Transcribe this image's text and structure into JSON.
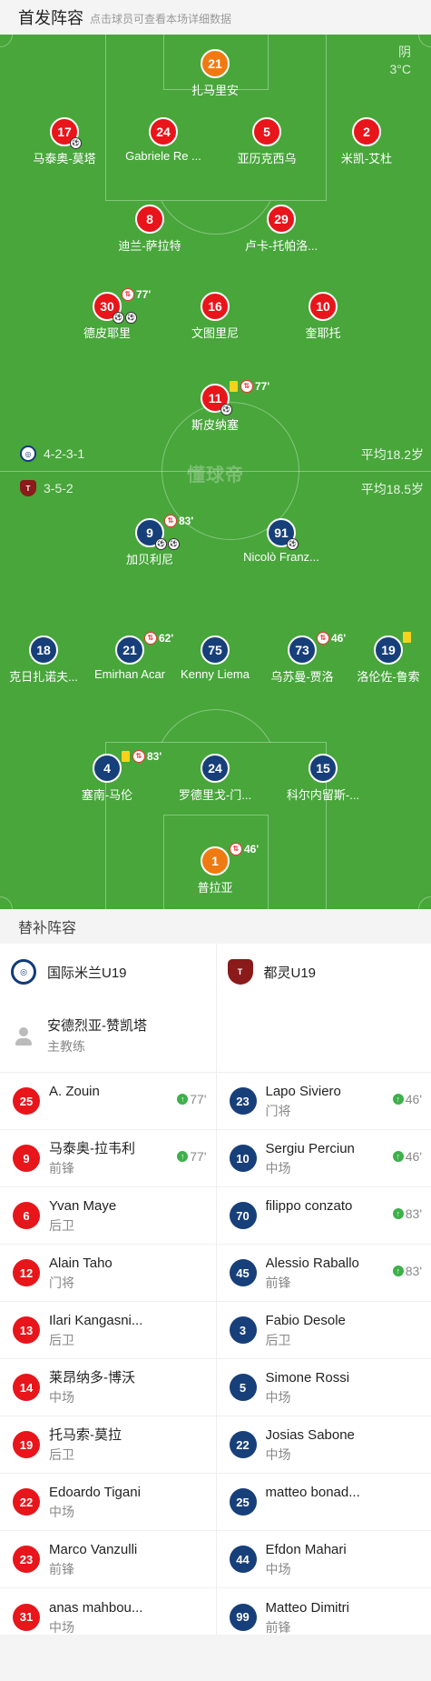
{
  "header": {
    "title": "首发阵容",
    "hint": "点击球员可查看本场详细数据"
  },
  "weather": {
    "condition": "阴",
    "temp": "3°C"
  },
  "watermark": "懂球帝",
  "home": {
    "formation": "4-2-3-1",
    "avg_age": "平均18.2岁"
  },
  "away": {
    "formation": "3-5-2",
    "avg_age": "平均18.5岁"
  },
  "home_players": [
    {
      "num": "21",
      "name": "扎马里安",
      "color": "orange"
    },
    {
      "num": "17",
      "name": "马泰奥-莫塔",
      "color": "red",
      "goals": "1"
    },
    {
      "num": "24",
      "name": "Gabriele Re ...",
      "color": "red"
    },
    {
      "num": "5",
      "name": "亚历克西乌",
      "color": "red"
    },
    {
      "num": "2",
      "name": "米凯-艾杜",
      "color": "red"
    },
    {
      "num": "8",
      "name": "迪兰-萨拉特",
      "color": "red"
    },
    {
      "num": "29",
      "name": "卢卡-托帕洛...",
      "color": "red"
    },
    {
      "num": "30",
      "name": "德皮耶里",
      "color": "red",
      "sub_min": "77'",
      "goals": "2"
    },
    {
      "num": "16",
      "name": "文图里尼",
      "color": "red"
    },
    {
      "num": "10",
      "name": "奎耶托",
      "color": "red"
    },
    {
      "num": "11",
      "name": "斯皮纳塞",
      "color": "red",
      "yellow": true,
      "sub_min": "77'",
      "goals": "1"
    }
  ],
  "away_players": [
    {
      "num": "9",
      "name": "加贝利尼",
      "color": "blue",
      "sub_min": "83'",
      "goals": "2"
    },
    {
      "num": "91",
      "name": "Nicolò Franz...",
      "color": "blue",
      "goals": "1"
    },
    {
      "num": "18",
      "name": "克日扎诺夫...",
      "color": "blue"
    },
    {
      "num": "21",
      "name": "Emirhan Acar",
      "color": "blue",
      "sub_min": "62'"
    },
    {
      "num": "75",
      "name": "Kenny Liema",
      "color": "blue"
    },
    {
      "num": "73",
      "name": "乌苏曼-贾洛",
      "color": "blue",
      "sub_min": "46'"
    },
    {
      "num": "19",
      "name": "洛伦佐-鲁索",
      "color": "blue",
      "yellow": true
    },
    {
      "num": "4",
      "name": "塞南-马伦",
      "color": "blue",
      "yellow": true,
      "sub_min": "83'"
    },
    {
      "num": "24",
      "name": "罗德里戈-门...",
      "color": "blue"
    },
    {
      "num": "15",
      "name": "科尔内留斯-...",
      "color": "blue"
    },
    {
      "num": "1",
      "name": "普拉亚",
      "color": "orange",
      "sub_min": "46'"
    }
  ],
  "bench": {
    "title": "替补阵容",
    "home_team": "国际米兰U19",
    "away_team": "都灵U19",
    "coach": {
      "name": "安德烈亚-赞凯塔",
      "role": "主教练"
    },
    "home_subs": [
      {
        "num": "25",
        "name": "A. Zouin",
        "pos": "",
        "sub": "77'"
      },
      {
        "num": "9",
        "name": "马泰奥-拉韦利",
        "pos": "前锋",
        "sub": "77'"
      },
      {
        "num": "6",
        "name": "Yvan Maye",
        "pos": "后卫",
        "sub": ""
      },
      {
        "num": "12",
        "name": "Alain Taho",
        "pos": "门将",
        "sub": ""
      },
      {
        "num": "13",
        "name": "Ilari Kangasni...",
        "pos": "后卫",
        "sub": ""
      },
      {
        "num": "14",
        "name": "莱昂纳多-博沃",
        "pos": "中场",
        "sub": ""
      },
      {
        "num": "19",
        "name": "托马索-莫拉",
        "pos": "后卫",
        "sub": ""
      },
      {
        "num": "22",
        "name": "Edoardo Tigani",
        "pos": "中场",
        "sub": ""
      },
      {
        "num": "23",
        "name": "Marco Vanzulli",
        "pos": "前锋",
        "sub": ""
      },
      {
        "num": "31",
        "name": "anas mahbou...",
        "pos": "中场",
        "sub": ""
      }
    ],
    "away_subs": [
      {
        "num": "23",
        "name": "Lapo Siviero",
        "pos": "门将",
        "sub": "46'"
      },
      {
        "num": "10",
        "name": "Sergiu Perciun",
        "pos": "中场",
        "sub": "46'"
      },
      {
        "num": "70",
        "name": "filippo conzato",
        "pos": "",
        "sub": "83'"
      },
      {
        "num": "45",
        "name": "Alessio Raballo",
        "pos": "前锋",
        "sub": "83'"
      },
      {
        "num": "3",
        "name": "Fabio Desole",
        "pos": "后卫",
        "sub": ""
      },
      {
        "num": "5",
        "name": "Simone Rossi",
        "pos": "中场",
        "sub": ""
      },
      {
        "num": "22",
        "name": "Josias Sabone",
        "pos": "中场",
        "sub": ""
      },
      {
        "num": "25",
        "name": "matteo bonad...",
        "pos": "",
        "sub": ""
      },
      {
        "num": "44",
        "name": "Efdon Mahari",
        "pos": "中场",
        "sub": ""
      },
      {
        "num": "99",
        "name": "Matteo Dimitri",
        "pos": "前锋",
        "sub": ""
      }
    ]
  }
}
